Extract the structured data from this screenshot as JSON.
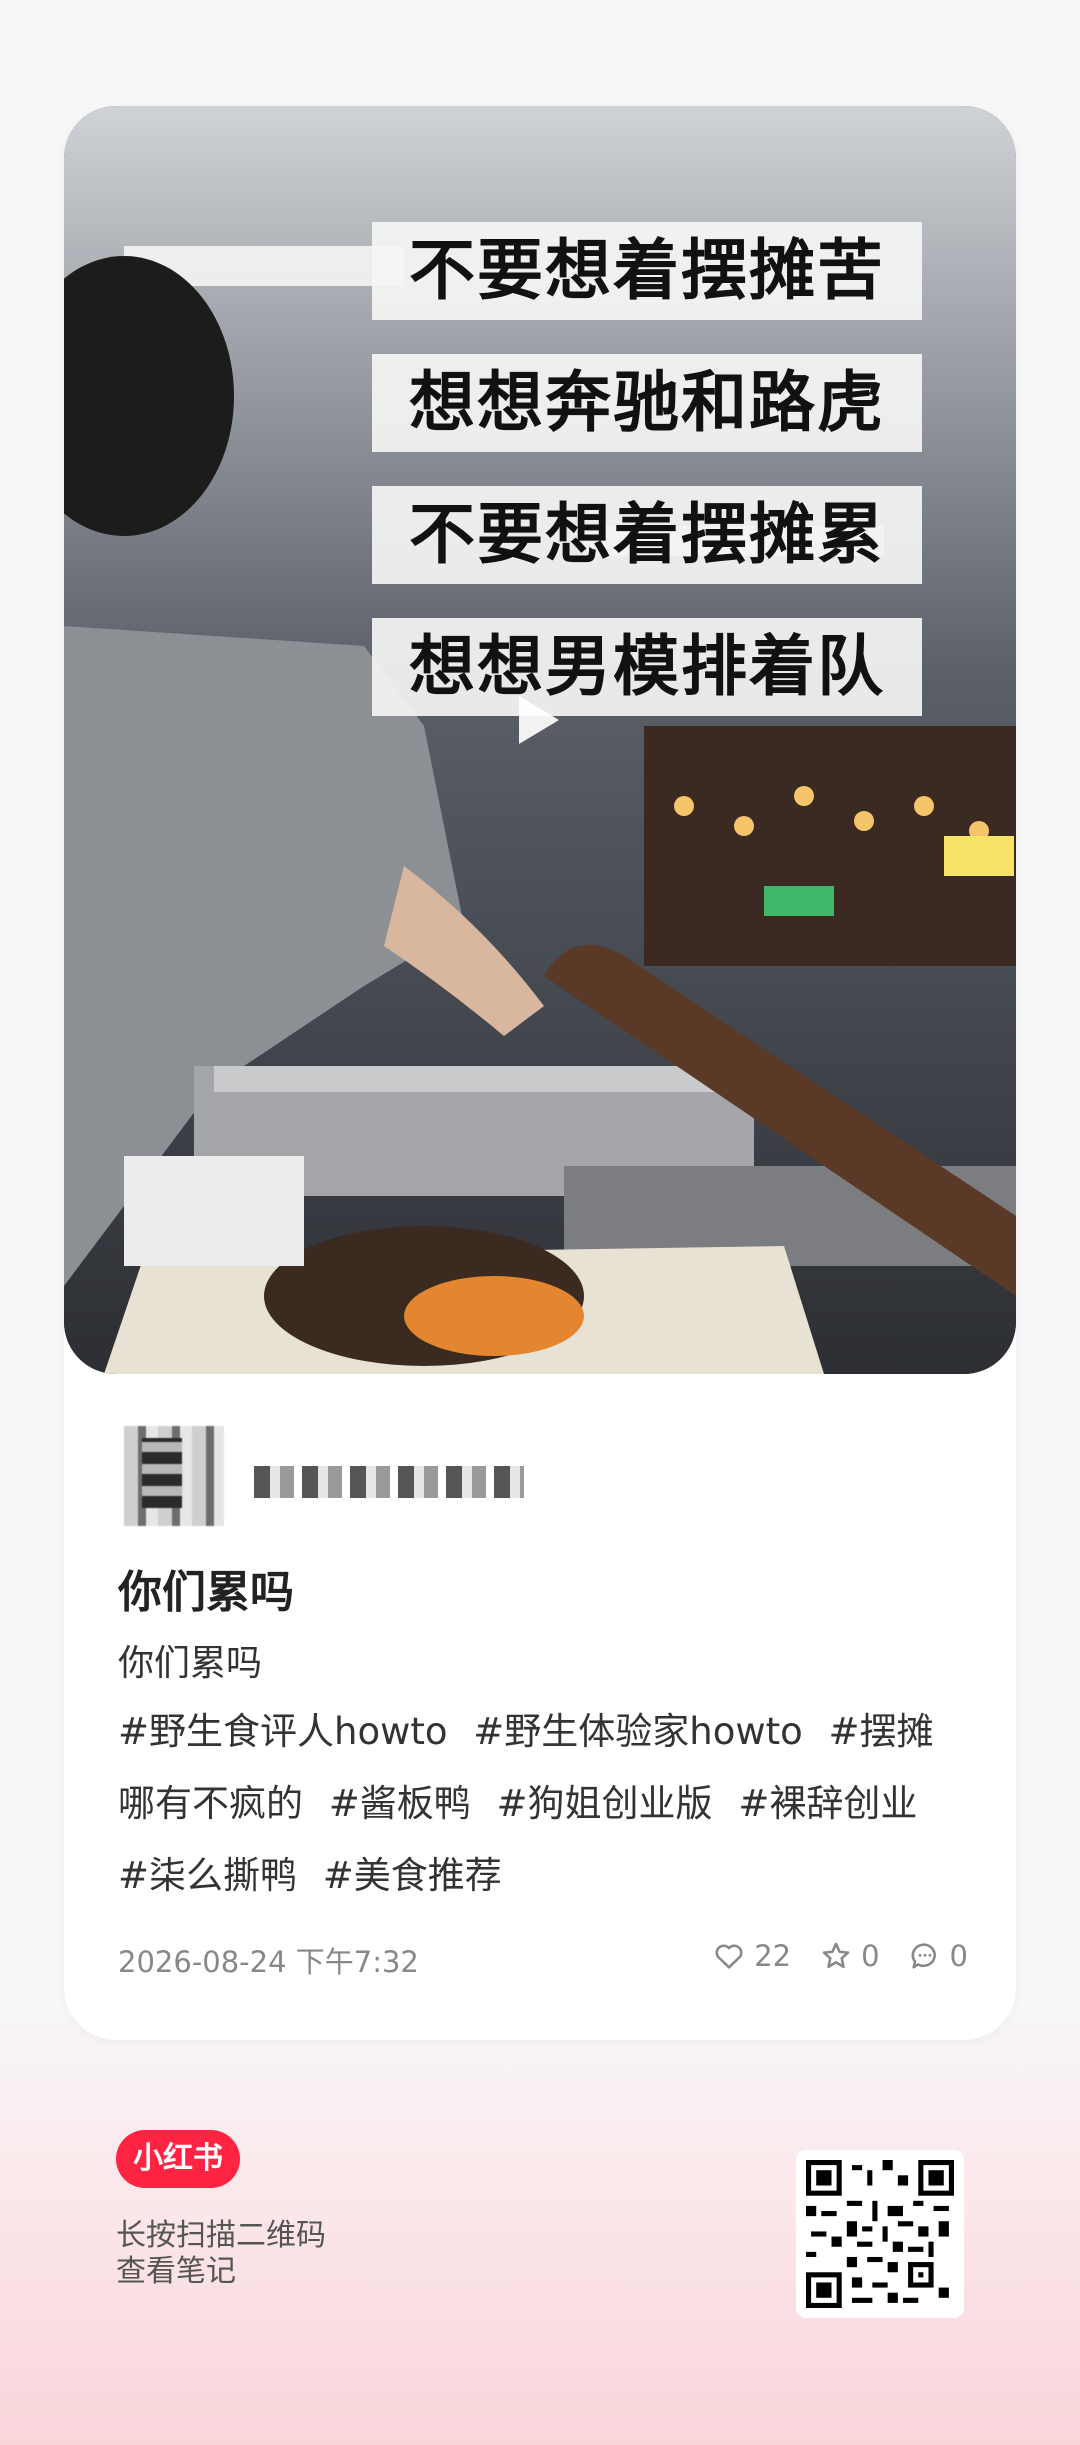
{
  "card": {
    "captions": [
      "不要想着摆摊苦",
      "想想奔驰和路虎",
      "不要想着摆摊累",
      "想想男模排着队"
    ],
    "play_icon": "play-icon"
  },
  "author": {
    "nickname": "■■■■■■■"
  },
  "note": {
    "title": "你们累吗",
    "description": "你们累吗",
    "tags": [
      "#野生食评人howto",
      "#野生体验家howto",
      "#摆摊哪有不疯的",
      "#酱板鸭",
      "#狗姐创业版",
      "#裸辞创业",
      "#柒么撕鸭",
      "#美食推荐"
    ]
  },
  "meta": {
    "date": "2026-08-24 下午7:32",
    "likes": "22",
    "collects": "0",
    "comments": "0"
  },
  "footer": {
    "logo": "小红书",
    "hint_line1": "长按扫描二维码",
    "hint_line2": "查看笔记"
  },
  "colors": {
    "brand": "#ff2442",
    "card_bg": "#ffffff",
    "footer_pink": "#f9d5da"
  }
}
